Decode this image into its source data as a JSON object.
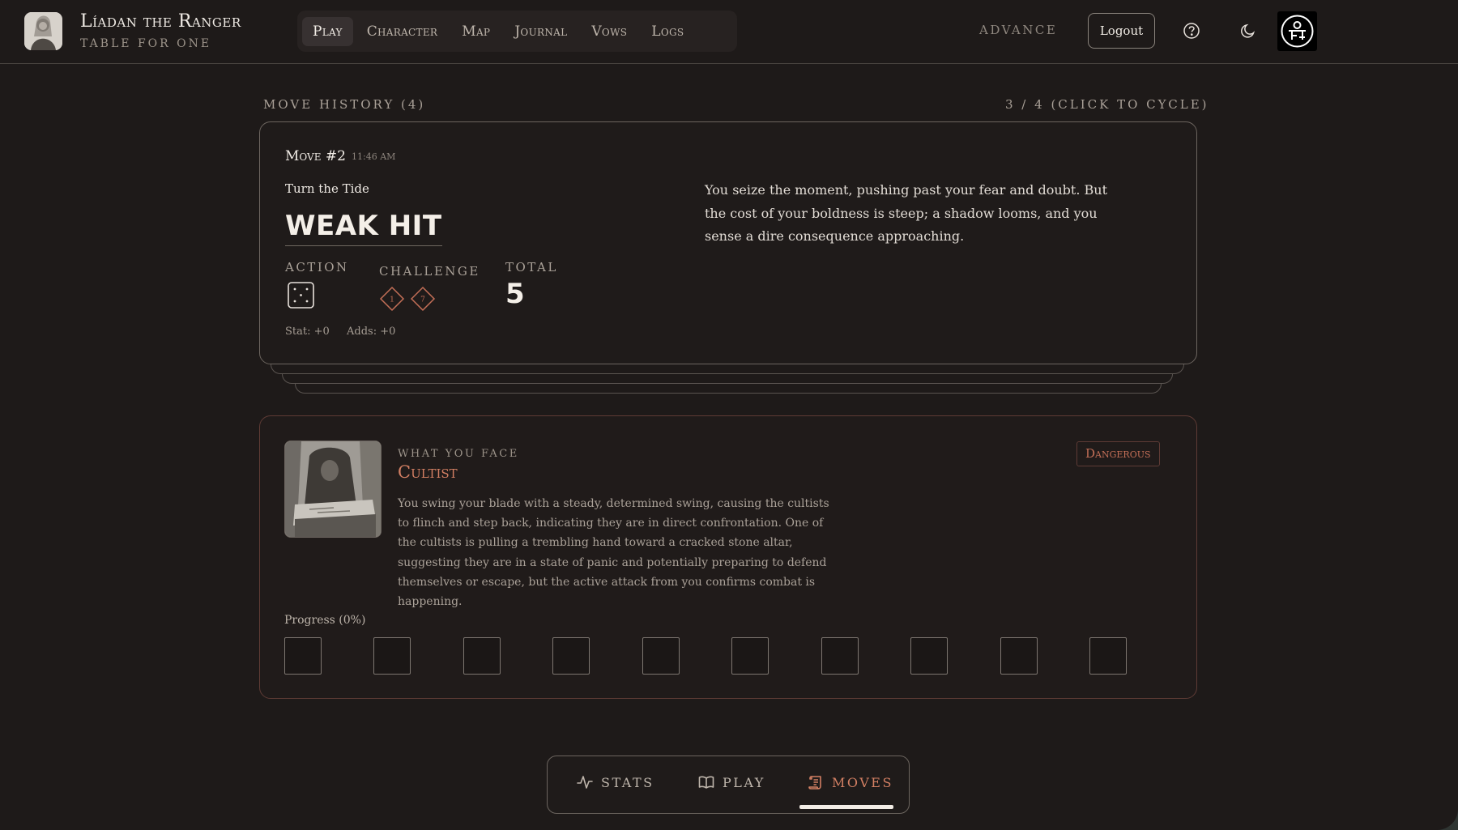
{
  "header": {
    "title": "Líadan the Ranger",
    "subtitle": "Table for One",
    "nav": [
      {
        "label": "Play",
        "active": true
      },
      {
        "label": "Character",
        "active": false
      },
      {
        "label": "Map",
        "active": false
      },
      {
        "label": "Journal",
        "active": false
      },
      {
        "label": "Vows",
        "active": false
      },
      {
        "label": "Logs",
        "active": false
      }
    ],
    "advance_label": "Advance",
    "logout_label": "Logout",
    "icons": [
      "help-icon",
      "moon-icon",
      "logo-icon"
    ]
  },
  "history": {
    "label": "Move History (4)",
    "cycle_label": "3 / 4 (click to cycle)",
    "move": {
      "title": "Move #2",
      "time": "11:46 AM",
      "name": "Turn the Tide",
      "result": "WEAK HIT",
      "action_label": "Action",
      "action_die": 5,
      "challenge_label": "Challenge",
      "challenge_dice": [
        "1",
        "7"
      ],
      "total_label": "Total",
      "total": "5",
      "stat": "Stat: +0",
      "adds": "Adds: +0",
      "narration": "You seize the moment, pushing past your fear and doubt. But the cost of your boldness is steep; a shadow looms, and you sense a dire consequence approaching."
    }
  },
  "foe": {
    "kicker": "What You Face",
    "name": "Cultist",
    "rank": "Dangerous",
    "description": "You swing your blade with a steady, determined swing, causing the cultists to flinch and step back, indicating they are in direct confrontation. One of the cultists is pulling a trembling hand toward a cracked stone altar, suggesting they are in a state of panic and potentially preparing to defend themselves or escape, but the active attack from you confirms combat is happening.",
    "progress_label": "Progress (0%)",
    "progress_fraction": 0,
    "track_boxes": 10
  },
  "tabs": [
    {
      "label": "Stats",
      "icon": "activity-icon",
      "active": false
    },
    {
      "label": "Play",
      "icon": "book-icon",
      "active": false
    },
    {
      "label": "Moves",
      "icon": "scroll-icon",
      "active": true
    }
  ],
  "colors": {
    "accent": "#d27f63",
    "background": "#1e1a19",
    "card_border": "#6c655f",
    "foe_border": "#5e3b35"
  }
}
